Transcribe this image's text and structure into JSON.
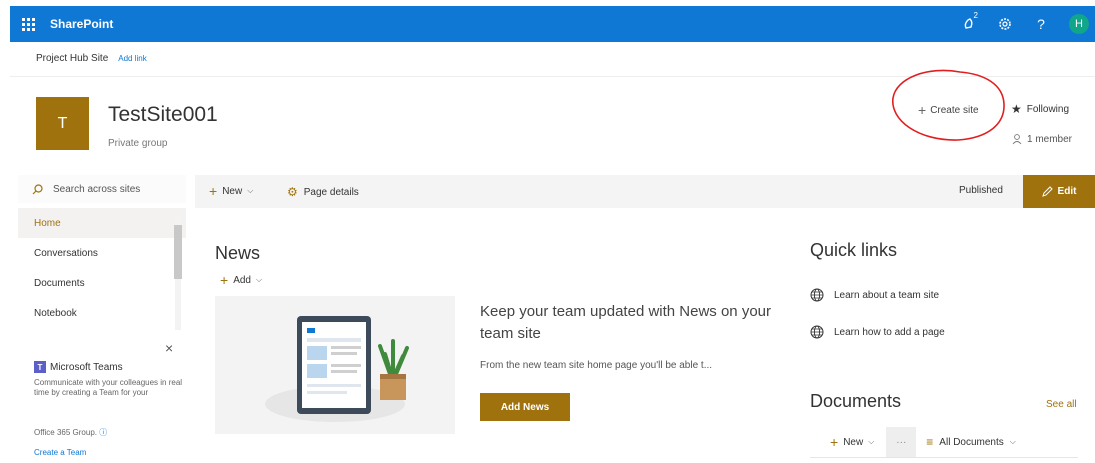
{
  "suitebar": {
    "brand": "SharePoint",
    "notification_count": "2",
    "help": "?",
    "avatar_initial": "H"
  },
  "hub": {
    "title": "Project Hub Site",
    "add_link": "Add link"
  },
  "site": {
    "logo_letter": "T",
    "title": "TestSite001",
    "subtitle": "Private group",
    "create_site": "Create site",
    "following": "Following",
    "members": "1 member"
  },
  "leftnav": {
    "search_placeholder": "Search across sites",
    "items": [
      {
        "label": "Home"
      },
      {
        "label": "Conversations"
      },
      {
        "label": "Documents"
      },
      {
        "label": "Notebook"
      }
    ]
  },
  "teams_promo": {
    "title": "Microsoft Teams",
    "description": "Communicate with your colleagues in real time by creating a Team for your",
    "info": "Office 365 Group.",
    "link": "Create a Team"
  },
  "commandbar": {
    "new": "New",
    "page_details": "Page details",
    "published": "Published",
    "edit": "Edit"
  },
  "news": {
    "title": "News",
    "add": "Add",
    "promo_title": "Keep your team updated with News on your team site",
    "promo_desc": "From the new team site home page you'll be able t...",
    "add_news_button": "Add News"
  },
  "quick_links": {
    "title": "Quick links",
    "items": [
      {
        "label": "Learn about a team site"
      },
      {
        "label": "Learn how to add a page"
      }
    ]
  },
  "documents": {
    "title": "Documents",
    "see_all": "See all",
    "new": "New",
    "more": "···",
    "view": "All Documents"
  },
  "colors": {
    "suitebar": "#0f78d4",
    "theme": "#a0720e",
    "annotation_circle": "#e02020"
  }
}
